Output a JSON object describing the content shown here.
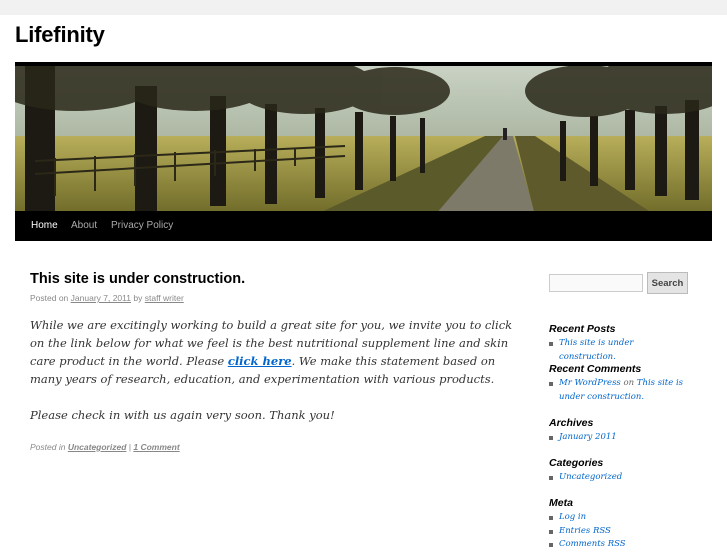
{
  "site": {
    "title": "Lifefinity"
  },
  "nav": {
    "items": [
      {
        "label": "Home",
        "active": true
      },
      {
        "label": "About",
        "active": false
      },
      {
        "label": "Privacy Policy",
        "active": false
      }
    ]
  },
  "post": {
    "title": "This site is under construction.",
    "meta": {
      "posted_on": "Posted on",
      "date": "January 7, 2011",
      "by": "by",
      "author": "staff writer"
    },
    "paragraph1_before": "While we are excitingly working to build a great site for you, we invite you to click on the link below for what we feel is the best nutritional supplement line and skin care product in the world. Please ",
    "paragraph1_link": "click here",
    "paragraph1_after": ". We make this statement based on many years of research, education, and experimentation with various products.",
    "paragraph2": "Please check in with us again very soon. Thank you!",
    "footer": {
      "posted_in": "Posted in",
      "category": "Uncategorized",
      "separator": "|",
      "comments": "1 Comment"
    }
  },
  "sidebar": {
    "search": {
      "placeholder": "",
      "button_label": "Search"
    },
    "recent_posts": {
      "title": "Recent Posts",
      "items": [
        "This site is under construction."
      ]
    },
    "recent_comments": {
      "title": "Recent Comments",
      "author": "Mr WordPress",
      "on": "on",
      "post": "This site is under construction."
    },
    "archives": {
      "title": "Archives",
      "items": [
        "January 2011"
      ]
    },
    "categories": {
      "title": "Categories",
      "items": [
        "Uncategorized"
      ]
    },
    "meta": {
      "title": "Meta",
      "items": [
        "Log in",
        "Entries RSS",
        "Comments RSS"
      ]
    }
  },
  "colors": {
    "page_bg": "#f1f1f1",
    "content_bg": "#ffffff",
    "nav_bg": "#000000",
    "link": "#0066cc",
    "meta_text": "#888888"
  }
}
